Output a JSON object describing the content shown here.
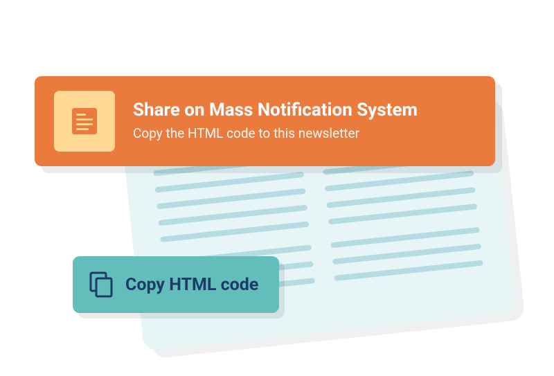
{
  "banner": {
    "title": "Share on Mass Notification System",
    "subtitle": "Copy the HTML code to this newsletter"
  },
  "copy_button": {
    "label": "Copy HTML code"
  },
  "colors": {
    "banner_bg": "#eb7b3d",
    "banner_icon_bg": "#ffd894",
    "doc_bg": "#e8f5f7",
    "doc_line": "#b5dbe3",
    "button_bg": "#62bdbb",
    "button_text": "#1e3a6b"
  }
}
